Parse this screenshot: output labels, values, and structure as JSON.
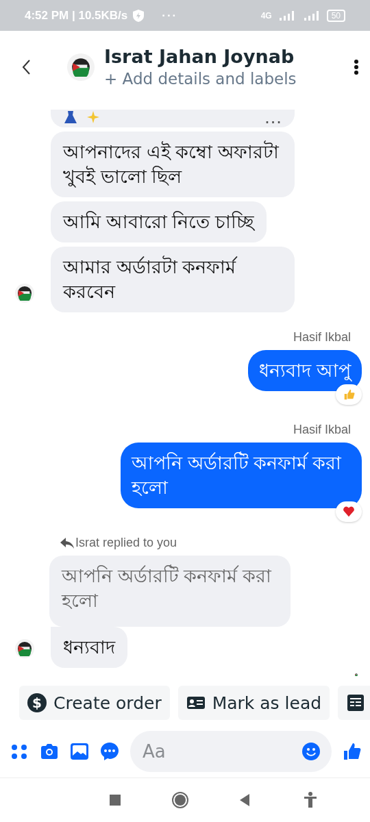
{
  "status_bar": {
    "time": "4:52 PM | 10.5KB/s",
    "more": "···",
    "network": "4G",
    "battery": "50"
  },
  "header": {
    "title": "Israt Jahan Joynab",
    "subtitle": "+ Add details and labels"
  },
  "messages": [
    {
      "kind": "incoming",
      "bubbles": [
        {
          "kind": "preview",
          "text": "…"
        },
        {
          "kind": "text",
          "text": "আপনাদের এই কম্বো অফারটা খুবই ভালো ছিল"
        },
        {
          "kind": "text",
          "text": "আমি আবারো নিতে চাচ্ছি"
        },
        {
          "kind": "text",
          "text": "আমার অর্ডারটা কনফার্ম করবেন"
        }
      ]
    },
    {
      "kind": "outgoing",
      "sender": "Hasif Ikbal",
      "text": "ধন্যবাদ আপু",
      "reaction": {
        "kind": "thumbs"
      }
    },
    {
      "kind": "outgoing",
      "sender": "Hasif Ikbal",
      "text": "আপনি অর্ডারটি কনফার্ম করা হলো",
      "reaction": {
        "kind": "heart"
      }
    },
    {
      "kind": "reply",
      "reply_label": "Israt replied to you",
      "quoted": "আপনি অর্ডারটি কনফার্ম করা হলো",
      "text": "ধন্যবাদ"
    }
  ],
  "chips": [
    {
      "kind": "dollar",
      "icon_text": "$",
      "label": "Create order"
    },
    {
      "kind": "card",
      "label": "Mark as lead"
    },
    {
      "kind": "table"
    }
  ],
  "composer": {
    "placeholder": "Aa"
  }
}
